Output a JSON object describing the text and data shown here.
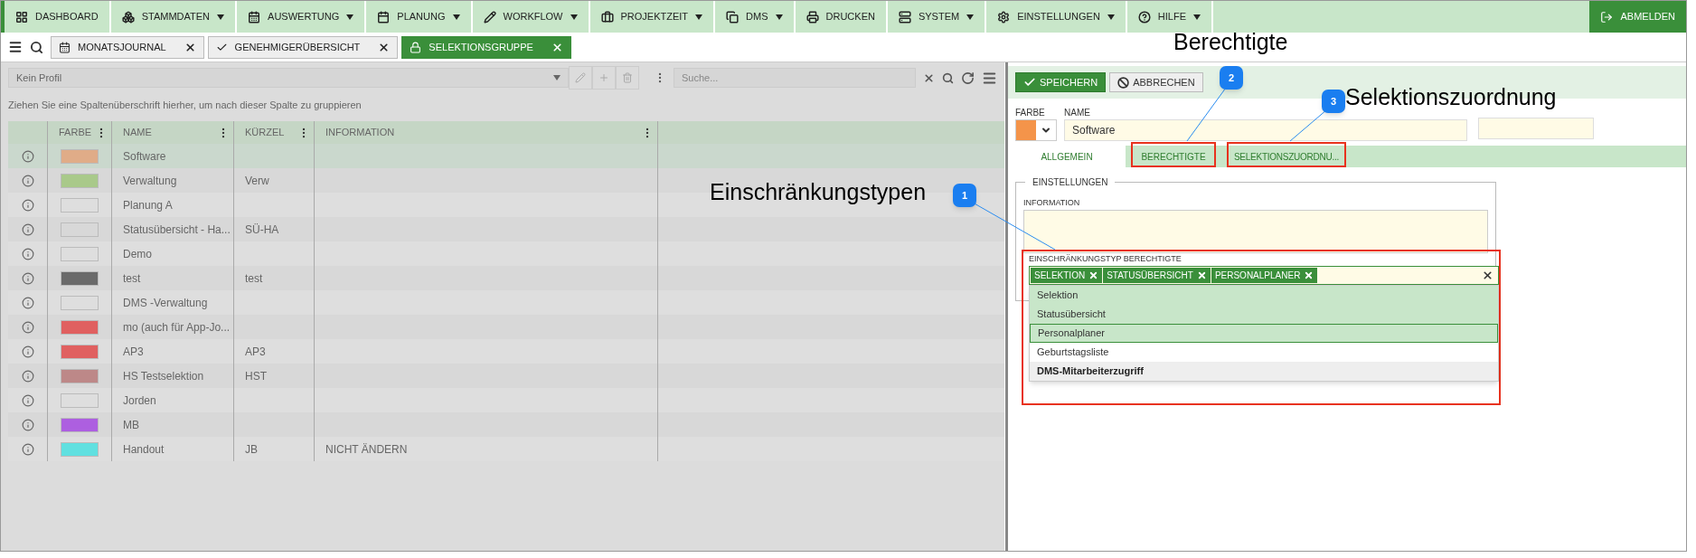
{
  "menu": [
    {
      "label": "DASHBOARD",
      "has_caret": false
    },
    {
      "label": "STAMMDATEN",
      "has_caret": true
    },
    {
      "label": "AUSWERTUNG",
      "has_caret": true
    },
    {
      "label": "PLANUNG",
      "has_caret": true
    },
    {
      "label": "WORKFLOW",
      "has_caret": true
    },
    {
      "label": "PROJEKTZEIT",
      "has_caret": true
    },
    {
      "label": "DMS",
      "has_caret": true
    },
    {
      "label": "DRUCKEN",
      "has_caret": false
    },
    {
      "label": "SYSTEM",
      "has_caret": true
    },
    {
      "label": "EINSTELLUNGEN",
      "has_caret": true
    },
    {
      "label": "HILFE",
      "has_caret": true
    }
  ],
  "logout": "ABMELDEN",
  "tabs": [
    {
      "label": "MONATSJOURNAL",
      "selected": false
    },
    {
      "label": "GENEHMIGERÜBERSICHT",
      "selected": false
    },
    {
      "label": "SELEKTIONSGRUPPE",
      "selected": true
    }
  ],
  "list": {
    "profile": "Kein Profil",
    "search": {
      "placeholder": "Suche..."
    },
    "group_hint": "Ziehen Sie eine Spaltenüberschrift hierher, um nach dieser Spalte zu gruppieren",
    "columns": [
      "FARBE",
      "NAME",
      "KÜRZEL",
      "INFORMATION"
    ],
    "rows": [
      {
        "color": "#e0ac88",
        "name": "Software",
        "short": "",
        "info": "",
        "selected": true
      },
      {
        "color": "#a9c98a",
        "name": "Verwaltung",
        "short": "Verw",
        "info": "",
        "selected": false
      },
      {
        "name": "Planung A",
        "short": "",
        "info": "",
        "selected": false
      },
      {
        "name": "Statusübersicht - Ha...",
        "short": "SÜ-HA",
        "info": "",
        "selected": false
      },
      {
        "name": "Demo",
        "short": "",
        "info": "",
        "selected": false
      },
      {
        "color": "#6a6a6a",
        "name": "test",
        "short": "test",
        "info": "",
        "selected": false
      },
      {
        "name": "DMS -Verwaltung",
        "short": "",
        "info": "",
        "selected": false
      },
      {
        "color": "#e06060",
        "name": "mo (auch für App-Jo...",
        "short": "",
        "info": "",
        "selected": false
      },
      {
        "color": "#e06060",
        "name": "AP3",
        "short": "AP3",
        "info": "",
        "selected": false
      },
      {
        "color": "#bd8888",
        "name": "HS Testselektion",
        "short": "HST",
        "info": "",
        "selected": false
      },
      {
        "name": "Jorden",
        "short": "",
        "info": "",
        "selected": false
      },
      {
        "color": "#ad5fe0",
        "name": "MB",
        "short": "",
        "info": "",
        "selected": false
      },
      {
        "color": "#60e0e0",
        "name": "Handout",
        "short": "JB",
        "info": "NICHT ÄNDERN",
        "selected": false
      }
    ]
  },
  "detail": {
    "save": "SPEICHERN",
    "cancel": "ABBRECHEN",
    "color_label": "FARBE",
    "color": "#f4944a",
    "name_label": "NAME",
    "name": "Software",
    "tabs": [
      {
        "label": "ALLGEMEIN",
        "selected": true
      },
      {
        "label": "BERECHTIGTE",
        "selected": false
      },
      {
        "label": "SELEKTIONSZUORDNU...",
        "selected": false
      }
    ],
    "group": "EINSTELLUNGEN",
    "info_label": "INFORMATION",
    "restriction_label": "EINSCHRÄNKUNGSTYP BERECHTIGTE",
    "chips": [
      "SELEKTION",
      "STATUSÜBERSICHT",
      "PERSONALPLANER"
    ],
    "options": [
      {
        "label": "Selektion",
        "selected": true,
        "focused": false,
        "hovered": false
      },
      {
        "label": "Statusübersicht",
        "selected": true,
        "focused": false,
        "hovered": false
      },
      {
        "label": "Personalplaner",
        "selected": true,
        "focused": true,
        "hovered": false
      },
      {
        "label": "Geburtstagsliste",
        "selected": false,
        "focused": false,
        "hovered": false
      },
      {
        "label": "DMS-Mitarbeiterzugriff",
        "selected": false,
        "focused": false,
        "hovered": true
      }
    ]
  },
  "annotations": [
    {
      "number": "1",
      "text": "Einschränkungstypen"
    },
    {
      "number": "2",
      "text": "Berechtigte"
    },
    {
      "number": "3",
      "text": "Selektionszuordnung"
    }
  ]
}
